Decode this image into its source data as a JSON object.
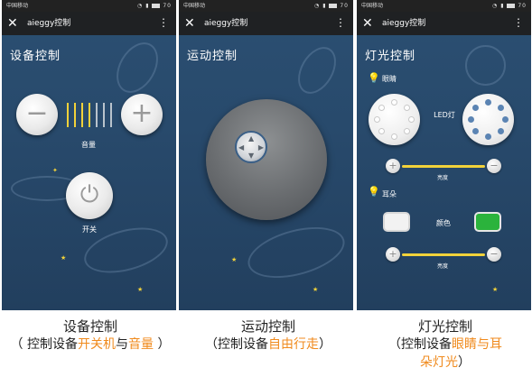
{
  "status": {
    "carrier": "中国移动",
    "battery": "70"
  },
  "app": {
    "title": "aieggy控制",
    "close_glyph": "✕",
    "more_glyph": "⋮"
  },
  "panel1": {
    "screen_title": "设备控制",
    "minus_glyph": "−",
    "plus_glyph": "+",
    "volume_label": "音量",
    "power_glyph": "⏻",
    "power_label": "开关",
    "volume_level": 4,
    "volume_total": 7
  },
  "panel2": {
    "screen_title": "运动控制"
  },
  "panel3": {
    "screen_title": "灯光控制",
    "eyes_label": "眼睛",
    "led_label": "LED灯",
    "brightness_label_1": "亮度",
    "ears_label": "耳朵",
    "color_label": "颜色",
    "brightness_label_2": "亮度",
    "plus_glyph": "+",
    "minus_glyph": "−",
    "eye_dot_color": "#5b84b3",
    "color_off": "#f2f2f2",
    "color_on": "#2bb33c"
  },
  "captions": {
    "c1_title": "设备控制",
    "c1_prefix": "（ 控制设备",
    "c1_hl1": "开关机",
    "c1_mid": "与",
    "c1_hl2": "音量",
    "c1_suffix": " ）",
    "c2_title": "运动控制",
    "c2_prefix": "（控制设备",
    "c2_hl": "自由行走",
    "c2_suffix": "）",
    "c3_title": "灯光控制",
    "c3_prefix": "（控制设备",
    "c3_hl1": "眼睛与耳",
    "c3_hl2": "朵灯光",
    "c3_suffix": "）"
  },
  "colors": {
    "accent": "#f08a1c",
    "star": "#f2d23a",
    "background": "#284a6c"
  }
}
